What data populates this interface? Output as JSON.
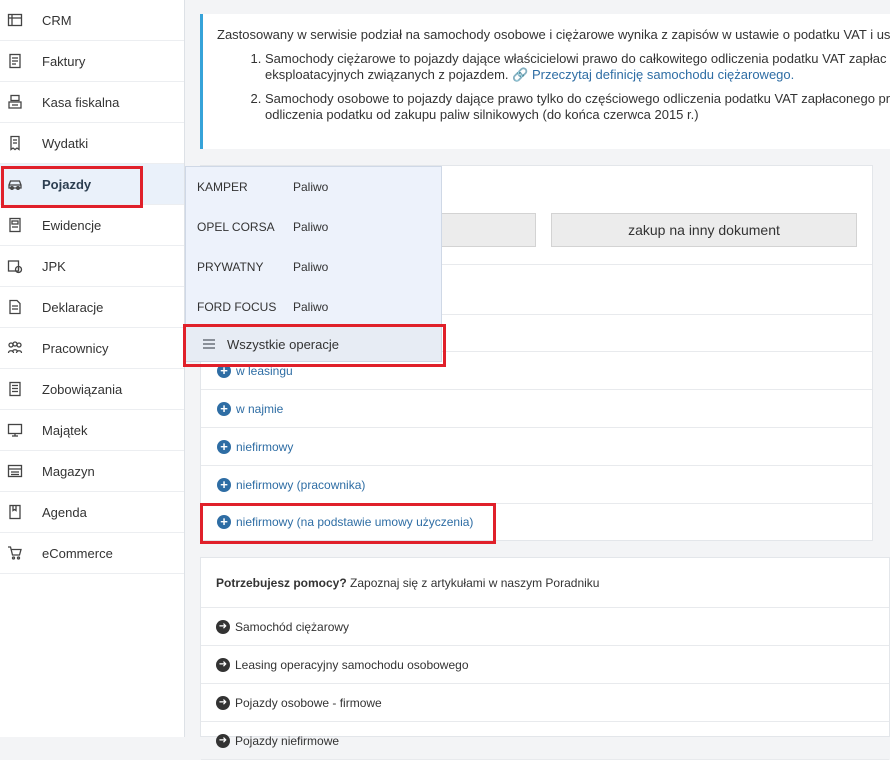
{
  "sidebar": {
    "items": [
      {
        "label": "CRM",
        "icon": "crm-icon"
      },
      {
        "label": "Faktury",
        "icon": "invoice-icon"
      },
      {
        "label": "Kasa fiskalna",
        "icon": "cash-register-icon"
      },
      {
        "label": "Wydatki",
        "icon": "expenses-icon"
      },
      {
        "label": "Pojazdy",
        "icon": "car-icon"
      },
      {
        "label": "Ewidencje",
        "icon": "records-icon"
      },
      {
        "label": "JPK",
        "icon": "jpk-icon"
      },
      {
        "label": "Deklaracje",
        "icon": "declarations-icon"
      },
      {
        "label": "Pracownicy",
        "icon": "employees-icon"
      },
      {
        "label": "Zobowiązania",
        "icon": "liabilities-icon"
      },
      {
        "label": "Majątek",
        "icon": "assets-icon"
      },
      {
        "label": "Magazyn",
        "icon": "warehouse-icon"
      },
      {
        "label": "Agenda",
        "icon": "agenda-icon"
      },
      {
        "label": "eCommerce",
        "icon": "cart-icon"
      }
    ],
    "active": "Pojazdy"
  },
  "info": {
    "intro": "Zastosowany w serwisie podział na samochody osobowe i ciężarowe wynika z zapisów w ustawie o podatku VAT i us",
    "point1_line1": "Samochody ciężarowe to pojazdy dające właścicielowi prawo do całkowitego odliczenia podatku VAT zapłac",
    "point1_line2": "eksploatacyjnych związanych z pojazdem.",
    "point1_link": "Przeczytaj definicję samochodu ciężarowego.",
    "point2_line1": "Samochody osobowe to pojazdy dające prawo tylko do częściowego odliczenia podatku VAT zapłaconego pr",
    "point2_line2": "odliczenia podatku od zakupu paliw silnikowych (do końca czerwca 2015 r.)"
  },
  "panel": {
    "button_other_doc": "zakup na inny dokument",
    "rows": [
      {
        "label": "w leasingu"
      },
      {
        "label": "w najmie"
      },
      {
        "label": "niefirmowy"
      },
      {
        "label": "niefirmowy (pracownika)"
      },
      {
        "label": "niefirmowy (na podstawie umowy użyczenia)"
      }
    ]
  },
  "flyout": {
    "vehicles": [
      {
        "name": "KAMPER",
        "action": "Paliwo"
      },
      {
        "name": "OPEL CORSA",
        "action": "Paliwo"
      },
      {
        "name": "PRYWATNY",
        "action": "Paliwo"
      },
      {
        "name": "FORD FOCUS",
        "action": "Paliwo"
      }
    ],
    "all_operations": "Wszystkie operacje"
  },
  "help": {
    "title_bold": "Potrzebujesz pomocy?",
    "title_rest": " Zapoznaj się z artykułami w naszym Poradniku",
    "articles": [
      {
        "label": "Samochód ciężarowy"
      },
      {
        "label": "Leasing operacyjny samochodu osobowego"
      },
      {
        "label": "Pojazdy osobowe - firmowe"
      },
      {
        "label": "Pojazdy niefirmowe"
      }
    ]
  },
  "colors": {
    "accent": "#2e6da4",
    "highlight": "#e0202a",
    "info_border": "#36a3d9"
  }
}
